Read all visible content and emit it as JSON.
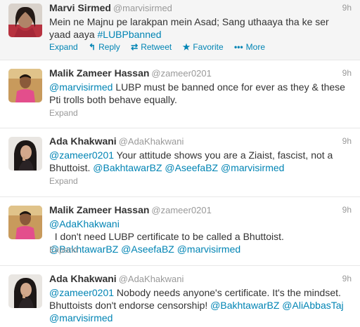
{
  "tweets": [
    {
      "fullname": "Marvi Sirmed",
      "username": "@marvisirmed",
      "time": "9h",
      "lines": [
        [
          {
            "t": "Mein ne Majnu pe larakpan mein Asad; Sang uthaaya tha ke ser",
            "link": false
          }
        ],
        [
          {
            "t": "yaad aaya ",
            "link": false
          },
          {
            "t": "#LUBPbanned",
            "link": true
          }
        ]
      ],
      "actions": {
        "expand": "Expand",
        "reply": "Reply",
        "retweet": "Retweet",
        "favorite": "Favorite",
        "more": "More"
      }
    },
    {
      "fullname": "Malik Zameer Hassan",
      "username": "@zameer0201",
      "time": "9h",
      "lines": [
        [
          {
            "t": "@marvisirmed",
            "link": true
          },
          {
            "t": " LUBP must be banned once for ever as they & these",
            "link": false
          }
        ],
        [
          {
            "t": "Pti trolls both behave equally.",
            "link": false
          }
        ]
      ],
      "expand": "Expand"
    },
    {
      "fullname": "Ada Khakwani",
      "username": "@AdaKhakwani",
      "time": "9h",
      "lines": [
        [
          {
            "t": "@zameer0201",
            "link": true
          },
          {
            "t": " Your attitude shows you are a Ziaist, fascist, not a",
            "link": false
          }
        ],
        [
          {
            "t": "Bhuttoist. ",
            "link": false
          },
          {
            "t": "@BakhtawarBZ",
            "link": true
          },
          {
            "t": " ",
            "link": false
          },
          {
            "t": "@AseefaBZ",
            "link": true
          },
          {
            "t": " ",
            "link": false
          },
          {
            "t": "@marvisirmed",
            "link": true
          }
        ]
      ],
      "expand": "Expand"
    },
    {
      "fullname": "Malik Zameer Hassan",
      "username": "@zameer0201",
      "time": "9h",
      "lines": [
        [
          {
            "t": "@AdaKhakwani",
            "link": true
          },
          {
            "t": "  I don't need LUBP certificate to be called a Bhuttoist.",
            "link": false
          }
        ],
        [
          {
            "t": "@BakhtawarBZ",
            "link": true
          },
          {
            "t": " ",
            "link": false
          },
          {
            "t": "@AseefaBZ",
            "link": true
          },
          {
            "t": " ",
            "link": false
          },
          {
            "t": "@marvisirmed",
            "link": true
          }
        ]
      ],
      "expand": "Expand"
    },
    {
      "fullname": "Ada Khakwani",
      "username": "@AdaKhakwani",
      "time": "9h",
      "lines": [
        [
          {
            "t": "@zameer0201",
            "link": true
          },
          {
            "t": " Nobody needs anyone's certificate. It's the mindset.",
            "link": false
          }
        ],
        [
          {
            "t": "Bhuttoists don't endorse censorship! ",
            "link": false
          },
          {
            "t": "@BakhtawarBZ",
            "link": true
          },
          {
            "t": " ",
            "link": false
          },
          {
            "t": "@AliAbbasTaj",
            "link": true
          }
        ],
        [
          {
            "t": "@marvisirmed",
            "link": true
          }
        ]
      ]
    }
  ],
  "colors": {
    "link": "#0084b4",
    "muted": "#999999",
    "text": "#333333",
    "divider": "#e8e8e8"
  },
  "icons": {
    "reply": "reply-arrow-icon",
    "retweet": "retweet-icon",
    "favorite": "star-icon",
    "more": "more-dots-icon"
  }
}
